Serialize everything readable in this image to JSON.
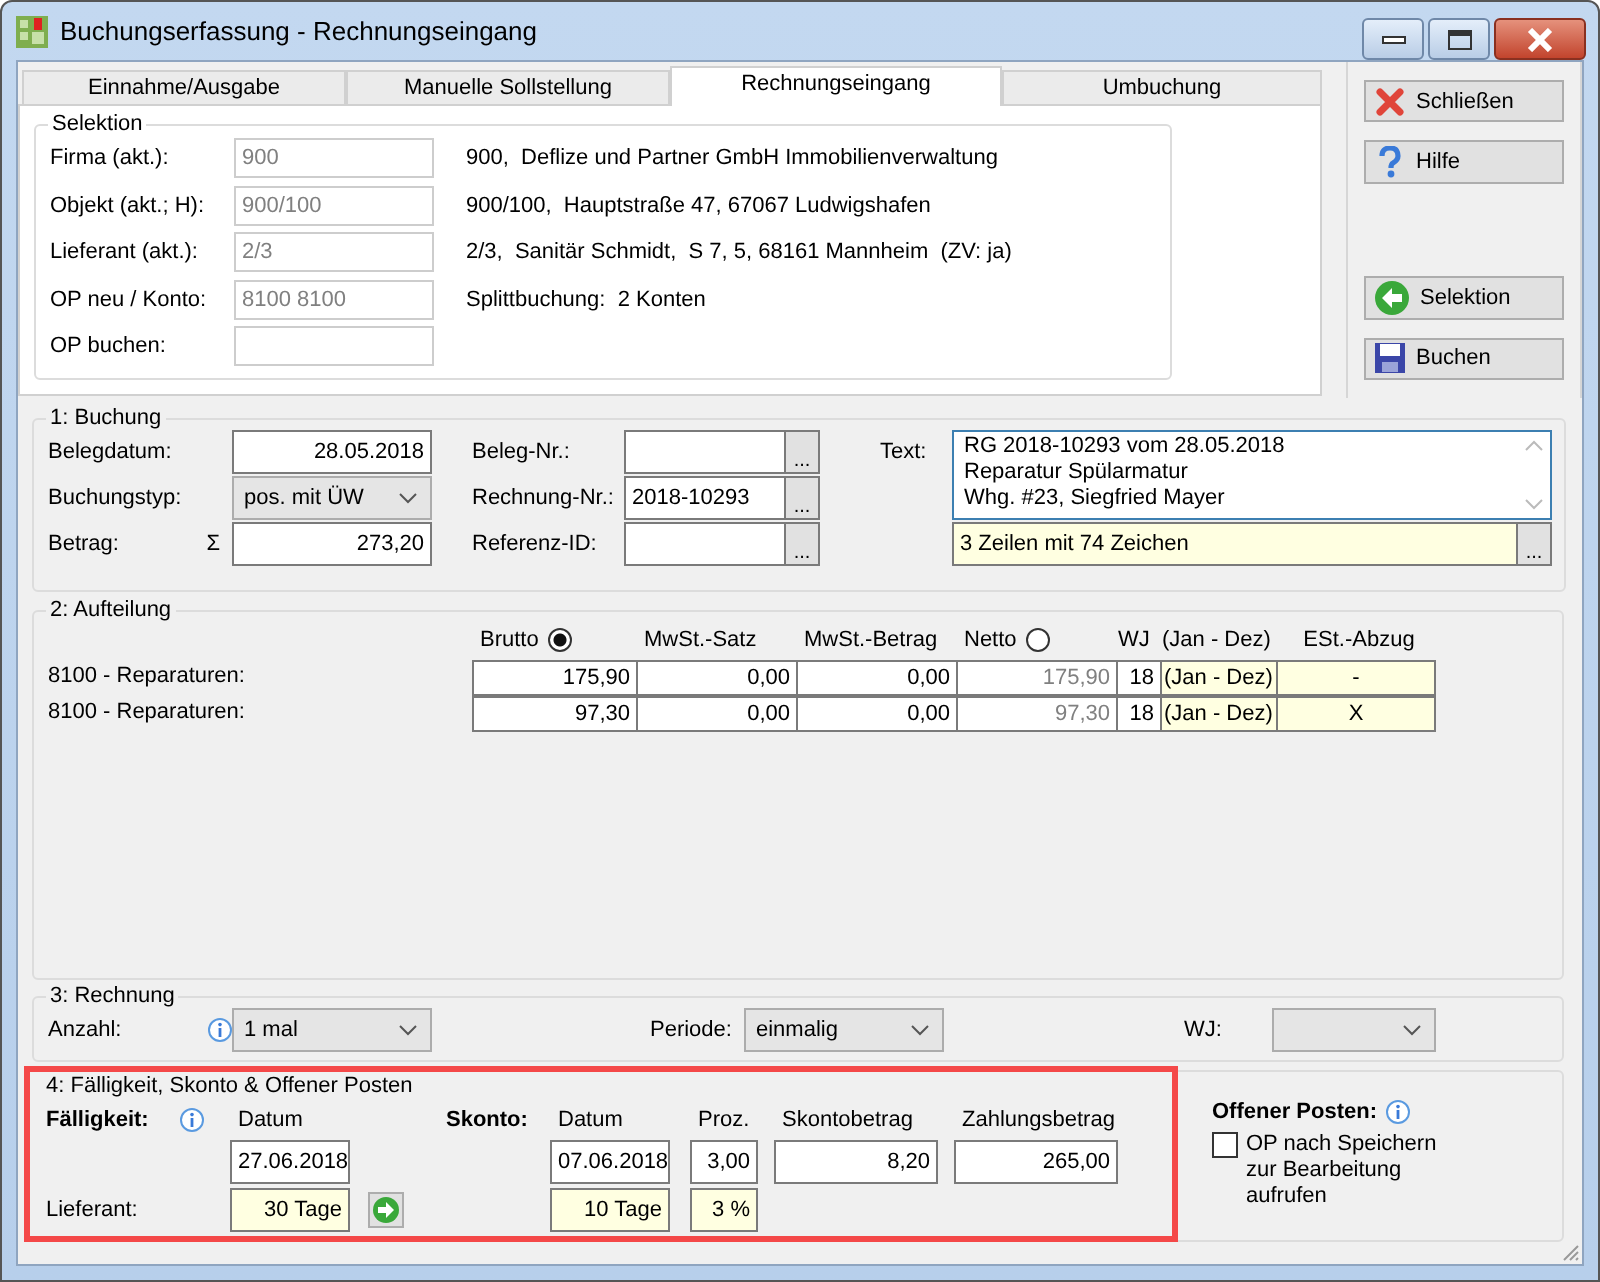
{
  "window": {
    "title": "Buchungserfassung - Rechnungseingang"
  },
  "tabs": [
    {
      "label": "Einnahme/Ausgabe",
      "selected": false
    },
    {
      "label": "Manuelle Sollstellung",
      "selected": false
    },
    {
      "label": "Rechnungseingang",
      "selected": true
    },
    {
      "label": "Umbuchung",
      "selected": false
    }
  ],
  "selection": {
    "title": "Selektion",
    "rows": [
      {
        "label": "Firma (akt.):",
        "value": "900",
        "info": "900,  Deflize und Partner GmbH Immobilienverwaltung"
      },
      {
        "label": "Objekt (akt.; H):",
        "value": "900/100",
        "info": "900/100,  Hauptstraße 47, 67067 Ludwigshafen"
      },
      {
        "label": "Lieferant (akt.):",
        "value": "2/3",
        "info": "2/3,  Sanitär Schmidt,  S 7, 5, 68161 Mannheim  (ZV: ja)"
      },
      {
        "label": "OP neu / Konto:",
        "value": "8100 8100",
        "info": "Splittbuchung:  2 Konten"
      },
      {
        "label": "OP buchen:"
      }
    ]
  },
  "actions": [
    {
      "label": "Schließen",
      "kind": "close"
    },
    {
      "label": "Hilfe",
      "kind": "help"
    },
    {
      "label": "Selektion",
      "kind": "back"
    },
    {
      "label": "Buchen",
      "kind": "save"
    }
  ],
  "booking": {
    "title": "1: Buchung",
    "voucher_date": {
      "label": "Belegdatum:",
      "value": "28.05.2018"
    },
    "booking_type": {
      "label": "Buchungstyp:",
      "value": "pos. mit ÜW"
    },
    "amount": {
      "label": "Betrag:",
      "symbol": "Σ",
      "value": "273,20"
    },
    "voucher_no": {
      "label": "Beleg-Nr.:",
      "button": "..."
    },
    "invoice_no": {
      "label": "Rechnung-Nr.:",
      "value": "2018-10293",
      "button": "..."
    },
    "reference_id": {
      "label": "Referenz-ID:",
      "button": "..."
    },
    "text": {
      "label": "Text:",
      "value": "RG 2018-10293 vom 28.05.2018\nReparatur Spülarmatur\nWhg. #23, Siegfried Mayer",
      "summary": "3 Zeilen mit 74 Zeichen",
      "button": "..."
    }
  },
  "split": {
    "title": "2: Aufteilung",
    "columns": [
      {
        "label": "Brutto",
        "kind": "radio",
        "selected": true
      },
      {
        "label": "MwSt.-Satz",
        "kind": "text"
      },
      {
        "label": "MwSt.-Betrag",
        "kind": "text"
      },
      {
        "label": "Netto",
        "kind": "radio",
        "selected": false
      },
      {
        "label": "WJ",
        "kind": "text"
      },
      {
        "label": "(Jan - Dez)",
        "kind": "text"
      },
      {
        "label": "ESt.-Abzug",
        "kind": "centered"
      }
    ],
    "rows": [
      {
        "account": "8100 - Reparaturen:",
        "cells": [
          {
            "text": "175,90",
            "kind": "amount"
          },
          {
            "text": "0,00",
            "kind": "amount"
          },
          {
            "text": "0,00",
            "kind": "amount"
          },
          {
            "text": "175,90",
            "kind": "derived"
          },
          {
            "text": "18",
            "kind": "amount"
          },
          {
            "text": "(Jan - Dez)",
            "kind": "note"
          },
          {
            "text": "-",
            "kind": "flag"
          }
        ]
      },
      {
        "account": "8100 - Reparaturen:",
        "cells": [
          {
            "text": "97,30",
            "kind": "amount"
          },
          {
            "text": "0,00",
            "kind": "amount"
          },
          {
            "text": "0,00",
            "kind": "amount"
          },
          {
            "text": "97,30",
            "kind": "derived"
          },
          {
            "text": "18",
            "kind": "amount"
          },
          {
            "text": "(Jan - Dez)",
            "kind": "note"
          },
          {
            "text": "X",
            "kind": "flag"
          }
        ]
      }
    ]
  },
  "invoice": {
    "title": "3: Rechnung",
    "count": {
      "label": "Anzahl:",
      "value": "1 mal"
    },
    "period": {
      "label": "Periode:",
      "value": "einmalig"
    },
    "fiscal_year": {
      "label": "WJ:"
    }
  },
  "due": {
    "title": "4: Fälligkeit, Skonto & Offener Posten",
    "heading": "Fälligkeit:",
    "date_header": "Datum",
    "date": "27.06.2018",
    "supplier_label": "Lieferant:",
    "supplier_terms": "30 Tage"
  },
  "discount": {
    "heading": "Skonto:",
    "date_header": "Datum",
    "percent_header": "Proz.",
    "amount_header": "Skontobetrag",
    "payment_header": "Zahlungsbetrag",
    "date": "07.06.2018",
    "percent": "3,00",
    "amount": "8,20",
    "payment": "265,00",
    "supplier_days": "10 Tage",
    "supplier_percent": "3 %"
  },
  "open_item": {
    "heading": "Offener Posten:",
    "option": {
      "label": "OP nach Speichern zur Bearbeitung aufrufen",
      "checked": false
    }
  }
}
